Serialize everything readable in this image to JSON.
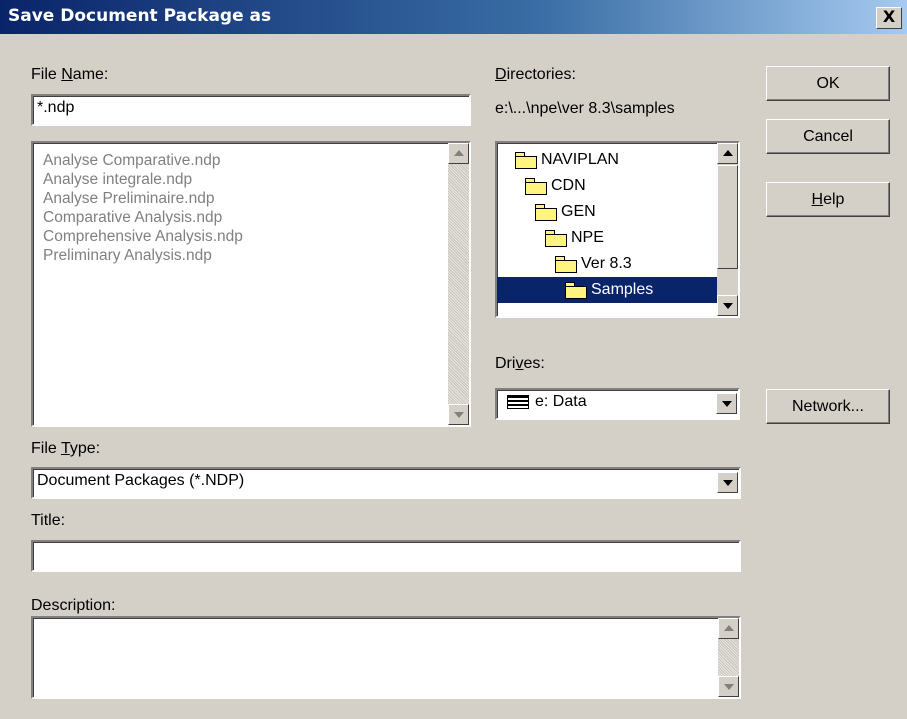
{
  "window": {
    "title": "Save Document Package as",
    "close_label": "X"
  },
  "file_name": {
    "label_pre": "File ",
    "label_key": "N",
    "label_post": "ame:",
    "value": "*.ndp",
    "files": [
      "Analyse Comparative.ndp",
      "Analyse integrale.ndp",
      "Analyse Preliminaire.ndp",
      "Comparative Analysis.ndp",
      "Comprehensive Analysis.ndp",
      "Preliminary Analysis.ndp"
    ]
  },
  "directories": {
    "label_pre": "",
    "label_key": "D",
    "label_post": "irectories:",
    "path": "e:\\...\\npe\\ver 8.3\\samples",
    "items": [
      "NAVIPLAN",
      "CDN",
      "GEN",
      "NPE",
      "Ver 8.3",
      "Samples"
    ],
    "selected": "Samples"
  },
  "drives": {
    "label_pre": "Dri",
    "label_key": "v",
    "label_post": "es:",
    "value": "e: Data"
  },
  "file_type": {
    "label_pre": "File ",
    "label_key": "T",
    "label_post": "ype:",
    "value": "Document Packages (*.NDP)"
  },
  "title_field": {
    "label": "Title:",
    "value": ""
  },
  "description_field": {
    "label": "Description:",
    "value": ""
  },
  "buttons": {
    "ok": "OK",
    "cancel": "Cancel",
    "help_key": "H",
    "help_rest": "elp",
    "network": "Network..."
  },
  "colors": {
    "title_bar": "#0a246a",
    "dialog_bg": "#d4d0c8",
    "selection": "#0a246a",
    "folder": "#fff480"
  }
}
